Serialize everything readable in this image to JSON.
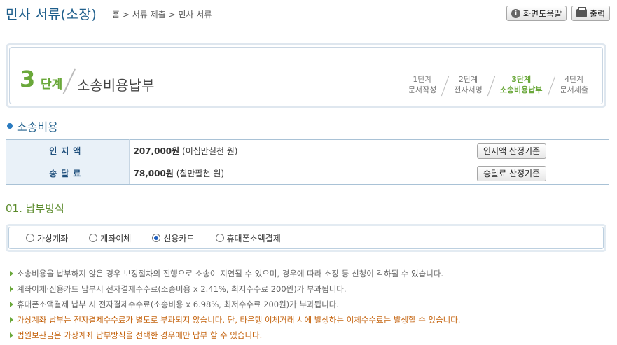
{
  "header": {
    "title": "민사 서류(소장)",
    "breadcrumb": "홈 > 서류 제출 > 민사 서류",
    "help_label": "화면도움말",
    "print_label": "출력"
  },
  "step": {
    "number": "3",
    "word": "단계",
    "title": "소송비용납부",
    "items": [
      {
        "top": "1단계",
        "bottom": "문서작성"
      },
      {
        "top": "2단계",
        "bottom": "전자서명"
      },
      {
        "top": "3단계",
        "bottom": "소송비용납부"
      },
      {
        "top": "4단계",
        "bottom": "문서제출"
      }
    ]
  },
  "fees": {
    "section_title": "소송비용",
    "rows": [
      {
        "label": "인지액",
        "amount": "207,000원",
        "words": "(이십만칠천 원)",
        "button": "인지액 산정기준"
      },
      {
        "label": "송달료",
        "amount": "78,000원",
        "words": "(칠만팔천 원)",
        "button": "송달료 산정기준"
      }
    ]
  },
  "payment": {
    "title": "01. 납부방식",
    "options": [
      "가상계좌",
      "계좌이체",
      "신용카드",
      "휴대폰소액결제"
    ],
    "selected": "신용카드"
  },
  "notes": [
    "소송비용을 납부하지 않은 경우 보정절차의 진행으로 소송이 지연될 수 있으며, 경우에 따라 소장 등 신청이 각하될 수 있습니다.",
    "계좌이체·신용카드 납부시 전자결제수수료(소송비용 x 2.41%, 최저수수료 200원)가 부과됩니다.",
    "휴대폰소액결제 납부 시 전자결제수수료(소송비용 x 6.98%, 최저수수료 200원)가 부과됩니다."
  ],
  "warnings": [
    "가상계좌 납부는 전자결제수수료가 별도로 부과되지 않습니다. 단, 타은행 이체거래 시에 발생하는 이체수수료는 발생할 수 있습니다.",
    "법원보관금은 가상계좌 납부방식을 선택한 경우에만 납부 할 수 있습니다."
  ]
}
